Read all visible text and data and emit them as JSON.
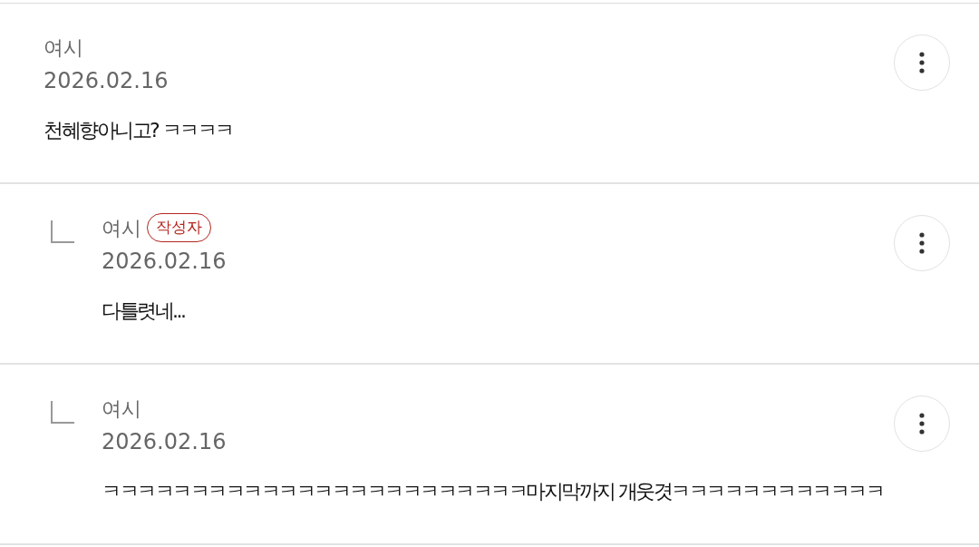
{
  "comments": [
    {
      "kind": "comment",
      "author": "여시",
      "date": "2026.02.16",
      "text": "천혜향아니고? ㅋㅋㅋㅋ"
    },
    {
      "kind": "reply",
      "author": "여시",
      "author_badge": "작성자",
      "date": "2026.02.16",
      "text": "다틀렷네..."
    },
    {
      "kind": "reply",
      "author": "여시",
      "date": "2026.02.16",
      "text": "ㅋㅋㅋㅋㅋㅋㅋㅋㅋㅋㅋㅋㅋㅋㅋㅋㅋㅋㅋㅋㅋㅋㅋㅋ마지막까지 개웃겻ㅋㅋㅋㅋㅋㅋㅋㅋㅋㅋㅋㅋ"
    }
  ]
}
